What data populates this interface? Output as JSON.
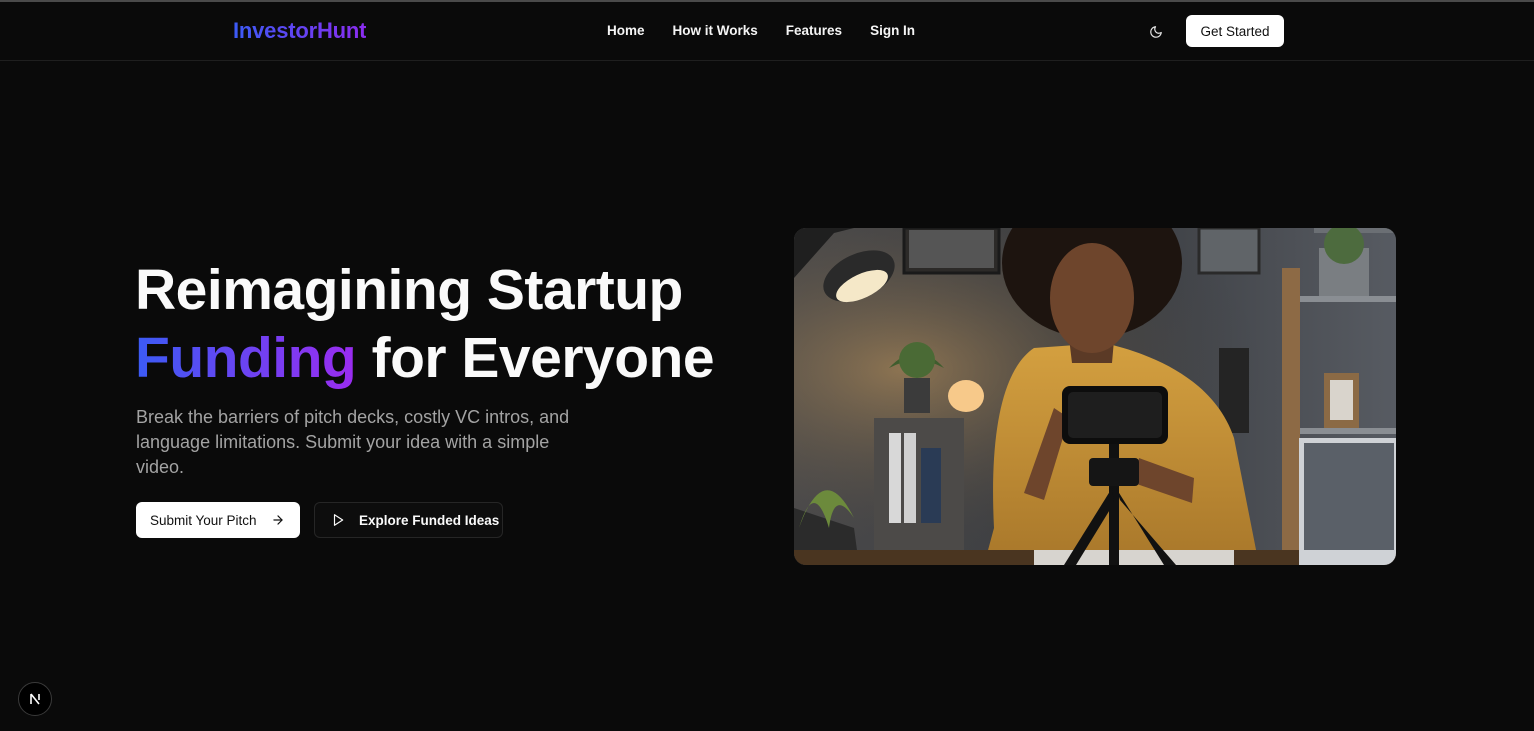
{
  "brand": {
    "name": "InvestorHunt"
  },
  "nav": {
    "items": [
      {
        "label": "Home"
      },
      {
        "label": "How it Works"
      },
      {
        "label": "Features"
      },
      {
        "label": "Sign In"
      }
    ]
  },
  "header": {
    "get_started_label": "Get Started",
    "theme_icon": "moon-icon"
  },
  "hero": {
    "title_line1": "Reimagining Startup",
    "title_accent": "Funding",
    "title_rest": " for Everyone",
    "subtitle": "Break the barriers of pitch decks, costly VC intros, and language limitations. Submit your idea with a simple video.",
    "primary_button": {
      "label": "Submit Your Pitch",
      "icon": "arrow-right-icon"
    },
    "secondary_button": {
      "label": "Explore Funded Ideas",
      "icon": "play-icon"
    }
  },
  "colors": {
    "background": "#0a0a0a",
    "gradient_start": "#3b5bf5",
    "gradient_end": "#9b2cf0",
    "muted_text": "#a3a3a3"
  },
  "dev_badge": {
    "icon": "nextjs-logo-icon"
  }
}
